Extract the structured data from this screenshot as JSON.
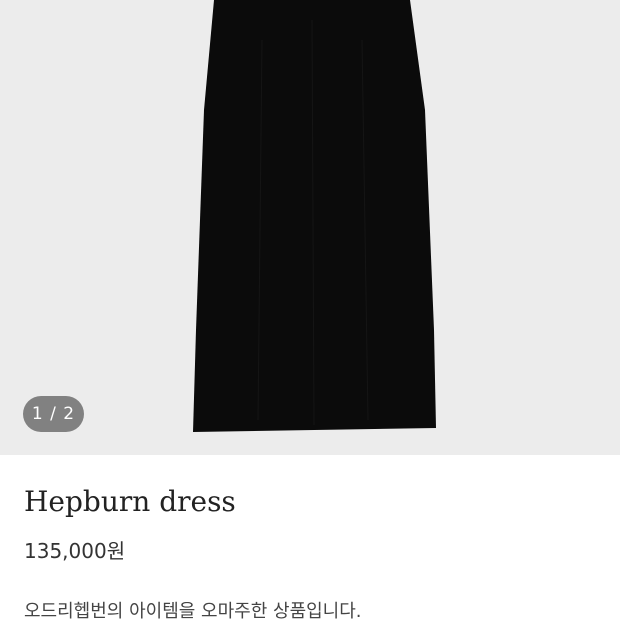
{
  "gallery": {
    "counter": "1 / 2",
    "image_icon": "black-knit-dress-image",
    "background_color": "#ececec",
    "dress_color": "#0b0b0b"
  },
  "product": {
    "name": "Hepburn dress",
    "price": "135,000원",
    "description": "오드리헵번의 아이템을 오마주한 상품입니다."
  }
}
